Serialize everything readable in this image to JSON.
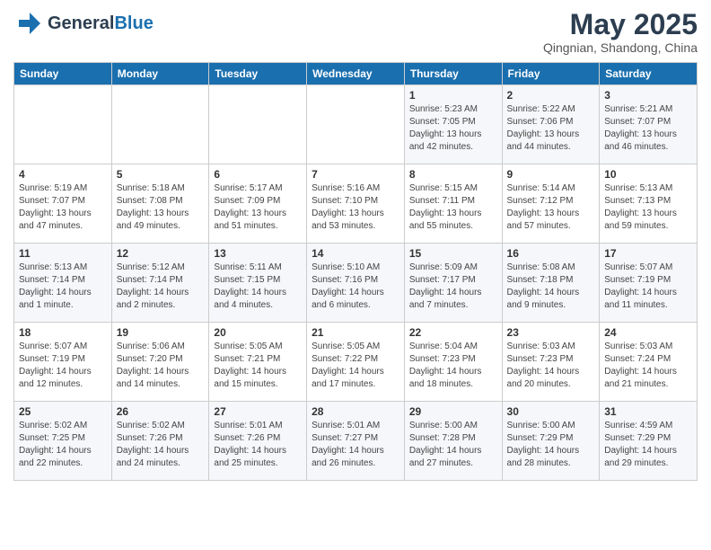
{
  "header": {
    "logo_general": "General",
    "logo_blue": "Blue",
    "month_title": "May 2025",
    "location": "Qingnian, Shandong, China"
  },
  "calendar": {
    "weekdays": [
      "Sunday",
      "Monday",
      "Tuesday",
      "Wednesday",
      "Thursday",
      "Friday",
      "Saturday"
    ],
    "weeks": [
      [
        {
          "day": "",
          "sunrise": "",
          "sunset": "",
          "daylight": ""
        },
        {
          "day": "",
          "sunrise": "",
          "sunset": "",
          "daylight": ""
        },
        {
          "day": "",
          "sunrise": "",
          "sunset": "",
          "daylight": ""
        },
        {
          "day": "",
          "sunrise": "",
          "sunset": "",
          "daylight": ""
        },
        {
          "day": "1",
          "sunrise": "Sunrise: 5:23 AM",
          "sunset": "Sunset: 7:05 PM",
          "daylight": "Daylight: 13 hours and 42 minutes."
        },
        {
          "day": "2",
          "sunrise": "Sunrise: 5:22 AM",
          "sunset": "Sunset: 7:06 PM",
          "daylight": "Daylight: 13 hours and 44 minutes."
        },
        {
          "day": "3",
          "sunrise": "Sunrise: 5:21 AM",
          "sunset": "Sunset: 7:07 PM",
          "daylight": "Daylight: 13 hours and 46 minutes."
        }
      ],
      [
        {
          "day": "4",
          "sunrise": "Sunrise: 5:19 AM",
          "sunset": "Sunset: 7:07 PM",
          "daylight": "Daylight: 13 hours and 47 minutes."
        },
        {
          "day": "5",
          "sunrise": "Sunrise: 5:18 AM",
          "sunset": "Sunset: 7:08 PM",
          "daylight": "Daylight: 13 hours and 49 minutes."
        },
        {
          "day": "6",
          "sunrise": "Sunrise: 5:17 AM",
          "sunset": "Sunset: 7:09 PM",
          "daylight": "Daylight: 13 hours and 51 minutes."
        },
        {
          "day": "7",
          "sunrise": "Sunrise: 5:16 AM",
          "sunset": "Sunset: 7:10 PM",
          "daylight": "Daylight: 13 hours and 53 minutes."
        },
        {
          "day": "8",
          "sunrise": "Sunrise: 5:15 AM",
          "sunset": "Sunset: 7:11 PM",
          "daylight": "Daylight: 13 hours and 55 minutes."
        },
        {
          "day": "9",
          "sunrise": "Sunrise: 5:14 AM",
          "sunset": "Sunset: 7:12 PM",
          "daylight": "Daylight: 13 hours and 57 minutes."
        },
        {
          "day": "10",
          "sunrise": "Sunrise: 5:13 AM",
          "sunset": "Sunset: 7:13 PM",
          "daylight": "Daylight: 13 hours and 59 minutes."
        }
      ],
      [
        {
          "day": "11",
          "sunrise": "Sunrise: 5:13 AM",
          "sunset": "Sunset: 7:14 PM",
          "daylight": "Daylight: 14 hours and 1 minute."
        },
        {
          "day": "12",
          "sunrise": "Sunrise: 5:12 AM",
          "sunset": "Sunset: 7:14 PM",
          "daylight": "Daylight: 14 hours and 2 minutes."
        },
        {
          "day": "13",
          "sunrise": "Sunrise: 5:11 AM",
          "sunset": "Sunset: 7:15 PM",
          "daylight": "Daylight: 14 hours and 4 minutes."
        },
        {
          "day": "14",
          "sunrise": "Sunrise: 5:10 AM",
          "sunset": "Sunset: 7:16 PM",
          "daylight": "Daylight: 14 hours and 6 minutes."
        },
        {
          "day": "15",
          "sunrise": "Sunrise: 5:09 AM",
          "sunset": "Sunset: 7:17 PM",
          "daylight": "Daylight: 14 hours and 7 minutes."
        },
        {
          "day": "16",
          "sunrise": "Sunrise: 5:08 AM",
          "sunset": "Sunset: 7:18 PM",
          "daylight": "Daylight: 14 hours and 9 minutes."
        },
        {
          "day": "17",
          "sunrise": "Sunrise: 5:07 AM",
          "sunset": "Sunset: 7:19 PM",
          "daylight": "Daylight: 14 hours and 11 minutes."
        }
      ],
      [
        {
          "day": "18",
          "sunrise": "Sunrise: 5:07 AM",
          "sunset": "Sunset: 7:19 PM",
          "daylight": "Daylight: 14 hours and 12 minutes."
        },
        {
          "day": "19",
          "sunrise": "Sunrise: 5:06 AM",
          "sunset": "Sunset: 7:20 PM",
          "daylight": "Daylight: 14 hours and 14 minutes."
        },
        {
          "day": "20",
          "sunrise": "Sunrise: 5:05 AM",
          "sunset": "Sunset: 7:21 PM",
          "daylight": "Daylight: 14 hours and 15 minutes."
        },
        {
          "day": "21",
          "sunrise": "Sunrise: 5:05 AM",
          "sunset": "Sunset: 7:22 PM",
          "daylight": "Daylight: 14 hours and 17 minutes."
        },
        {
          "day": "22",
          "sunrise": "Sunrise: 5:04 AM",
          "sunset": "Sunset: 7:23 PM",
          "daylight": "Daylight: 14 hours and 18 minutes."
        },
        {
          "day": "23",
          "sunrise": "Sunrise: 5:03 AM",
          "sunset": "Sunset: 7:23 PM",
          "daylight": "Daylight: 14 hours and 20 minutes."
        },
        {
          "day": "24",
          "sunrise": "Sunrise: 5:03 AM",
          "sunset": "Sunset: 7:24 PM",
          "daylight": "Daylight: 14 hours and 21 minutes."
        }
      ],
      [
        {
          "day": "25",
          "sunrise": "Sunrise: 5:02 AM",
          "sunset": "Sunset: 7:25 PM",
          "daylight": "Daylight: 14 hours and 22 minutes."
        },
        {
          "day": "26",
          "sunrise": "Sunrise: 5:02 AM",
          "sunset": "Sunset: 7:26 PM",
          "daylight": "Daylight: 14 hours and 24 minutes."
        },
        {
          "day": "27",
          "sunrise": "Sunrise: 5:01 AM",
          "sunset": "Sunset: 7:26 PM",
          "daylight": "Daylight: 14 hours and 25 minutes."
        },
        {
          "day": "28",
          "sunrise": "Sunrise: 5:01 AM",
          "sunset": "Sunset: 7:27 PM",
          "daylight": "Daylight: 14 hours and 26 minutes."
        },
        {
          "day": "29",
          "sunrise": "Sunrise: 5:00 AM",
          "sunset": "Sunset: 7:28 PM",
          "daylight": "Daylight: 14 hours and 27 minutes."
        },
        {
          "day": "30",
          "sunrise": "Sunrise: 5:00 AM",
          "sunset": "Sunset: 7:29 PM",
          "daylight": "Daylight: 14 hours and 28 minutes."
        },
        {
          "day": "31",
          "sunrise": "Sunrise: 4:59 AM",
          "sunset": "Sunset: 7:29 PM",
          "daylight": "Daylight: 14 hours and 29 minutes."
        }
      ]
    ]
  }
}
